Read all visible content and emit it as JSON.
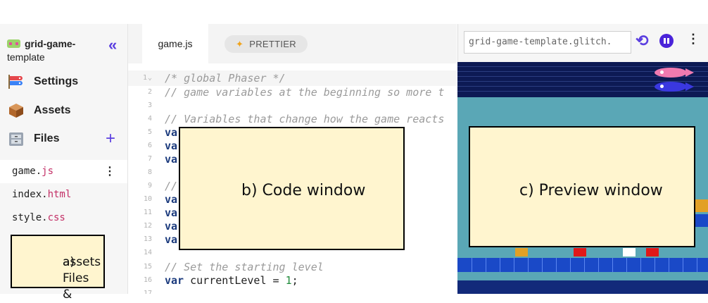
{
  "project": {
    "name_line1": "grid-game-",
    "name_line2": "template",
    "collapse_icon": "«"
  },
  "sidebar": {
    "nav": [
      {
        "label": "Settings",
        "icon": "settings-carp-icon"
      },
      {
        "label": "Assets",
        "icon": "assets-box-icon"
      },
      {
        "label": "Files",
        "icon": "files-cabinet-icon"
      }
    ],
    "add_icon": "+",
    "files": [
      {
        "base": "game.",
        "ext": "js",
        "menu": "⋮"
      },
      {
        "base": "index.",
        "ext": "html"
      },
      {
        "base": "style.",
        "ext": "css"
      }
    ]
  },
  "editor": {
    "tab": "game.js",
    "prettier": "PRETTIER",
    "prettier_icon": "✦",
    "fold_marker": "⌄",
    "lines": [
      {
        "n": "1",
        "text": "/* global Phaser */"
      },
      {
        "n": "2",
        "text": "// game variables  at the beginning so more t"
      },
      {
        "n": "3",
        "text": ""
      },
      {
        "n": "4",
        "text": "// Variables that change how the game reacts"
      },
      {
        "n": "5",
        "text": "var"
      },
      {
        "n": "6",
        "text": "var"
      },
      {
        "n": "7",
        "text": "var"
      },
      {
        "n": "8",
        "text": ""
      },
      {
        "n": "9",
        "text": "//"
      },
      {
        "n": "10",
        "text": "var"
      },
      {
        "n": "11",
        "text": "var"
      },
      {
        "n": "12",
        "text": "var"
      },
      {
        "n": "13",
        "text": "var"
      },
      {
        "n": "14",
        "text": ""
      },
      {
        "n": "15",
        "text": "// Set the starting level"
      },
      {
        "n": "16",
        "kw": "var",
        "id": " currentLevel ",
        "op": "= ",
        "num": "1",
        "end": ";"
      },
      {
        "n": "17",
        "text": ""
      }
    ]
  },
  "preview": {
    "url": "grid-game-template.glitch.",
    "reload_icon": "⟲",
    "menu_icon": "⋮"
  },
  "annotations": {
    "files_line1": "a) Files &",
    "files_line2": "assets",
    "code": "b) Code window",
    "preview": "c) Preview window"
  }
}
